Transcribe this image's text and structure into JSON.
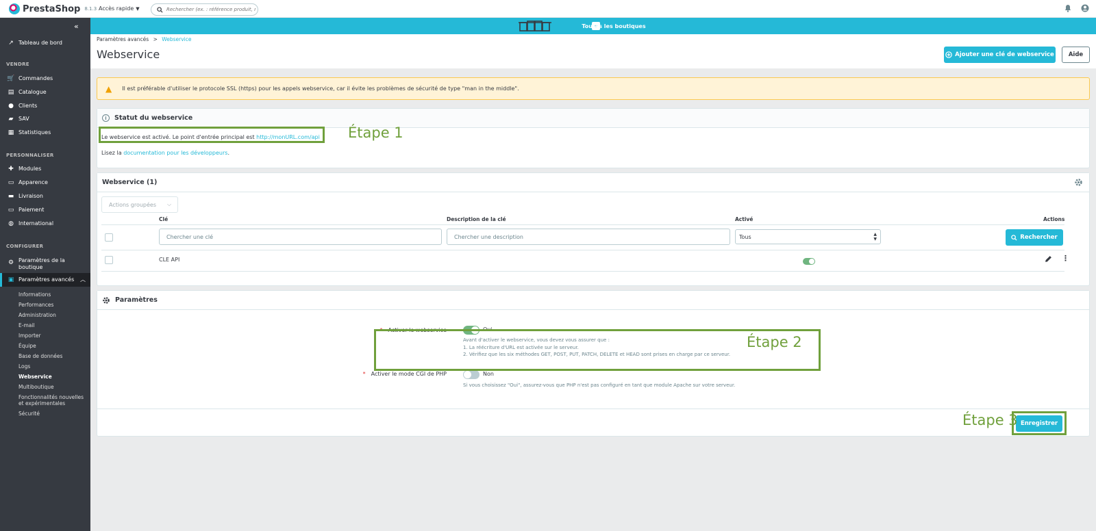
{
  "topbar": {
    "brand": "PrestaShop",
    "version": "8.1.3",
    "quick_access": "Accès rapide",
    "search_placeholder": "Rechercher (ex. : référence produit, no"
  },
  "shopbar": {
    "label": "Toutes les boutiques"
  },
  "sidebar": {
    "dashboard": "Tableau de bord",
    "sections": {
      "sell": "VENDRE",
      "custom": "PERSONNALISER",
      "config": "CONFIGURER"
    },
    "sell_items": [
      "Commandes",
      "Catalogue",
      "Clients",
      "SAV",
      "Statistiques"
    ],
    "custom_items": [
      "Modules",
      "Apparence",
      "Livraison",
      "Paiement",
      "International"
    ],
    "config_items": [
      "Paramètres de la boutique",
      "Paramètres avancés"
    ],
    "sub_items": [
      "Informations",
      "Performances",
      "Administration",
      "E-mail",
      "Importer",
      "Équipe",
      "Base de données",
      "Logs",
      "Webservice",
      "Multiboutique",
      "Fonctionnalités nouvelles et expérimentales",
      "Sécurité"
    ]
  },
  "header": {
    "breadcrumb_parent": "Paramètres avancés",
    "breadcrumb_sep": ">",
    "breadcrumb_current": "Webservice",
    "title": "Webservice",
    "add_button": "Ajouter une clé de webservice",
    "help_button": "Aide"
  },
  "alert": {
    "text": "Il est préférable d'utiliser le protocole SSL (https) pour les appels webservice, car il évite les problèmes de sécurité de type \"man in the middle\"."
  },
  "status": {
    "title": "Statut du webservice",
    "line1_text": "Le webservice est activé. Le point d'entrée principal est ",
    "line1_link": "http://monURL.com/api",
    "line2_text": "Lisez la ",
    "line2_link": "documentation pour les développeurs",
    "line2_end": "."
  },
  "list": {
    "title": "Webservice (1)",
    "bulk_actions": "Actions groupées",
    "columns": {
      "key": "Clé",
      "description": "Description de la clé",
      "active": "Activé",
      "actions": "Actions"
    },
    "filter_key_placeholder": "Chercher une clé",
    "filter_desc_placeholder": "Chercher une description",
    "filter_active": "Tous",
    "search_button": "Rechercher",
    "rows": [
      {
        "key": "CLE API",
        "description": "",
        "active": true
      }
    ]
  },
  "params": {
    "title": "Paramètres",
    "enable_ws_label": "Activer le webservice",
    "enable_ws_value": "Oui",
    "enable_ws_help": [
      "Avant d'activer le webservice, vous devez vous assurer que :",
      "1. La réécriture d'URL est activée sur le serveur.",
      "2. Vérifiez que les six méthodes GET, POST, PUT, PATCH, DELETE et HEAD sont prises en charge par ce serveur."
    ],
    "cgi_label": "Activer le mode CGI de PHP",
    "cgi_value": "Non",
    "cgi_help": "Si vous choisissez \"Oui\", assurez-vous que PHP n'est pas configuré en tant que module Apache sur votre serveur.",
    "save_button": "Enregistrer"
  },
  "annotations": {
    "step1": "Étape 1",
    "step2": "Étape 2",
    "step3": "Étape 3"
  },
  "colors": {
    "primary": "#25b9d7",
    "annotation": "#70a03c",
    "sidebar": "#363a41",
    "toggle_on": "#70b580"
  }
}
